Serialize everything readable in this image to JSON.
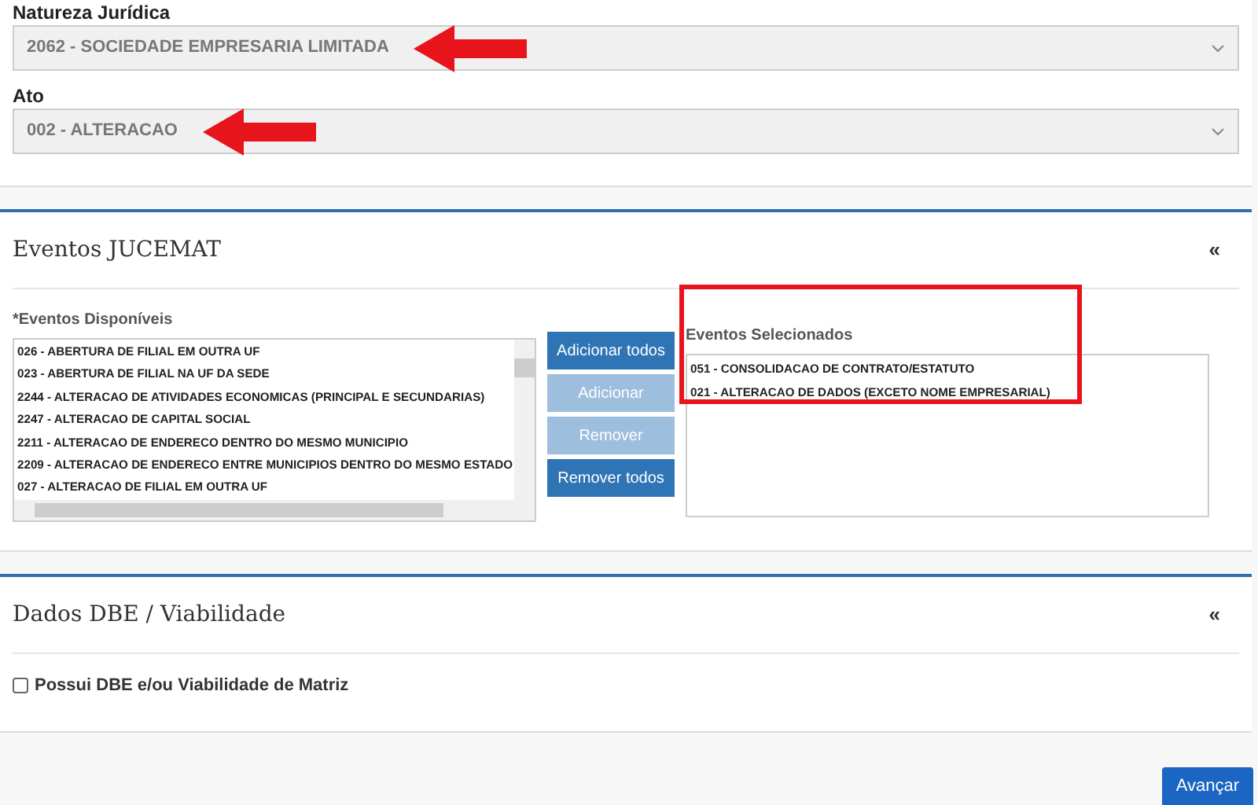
{
  "identificacao": {
    "fields": [
      {
        "label": "Natureza Jurídica",
        "value": "2062 - SOCIEDADE EMPRESARIA LIMITADA",
        "annotated": true
      },
      {
        "label": "Ato",
        "value": "002 - ALTERACAO",
        "annotated": true
      }
    ]
  },
  "eventos": {
    "title": "Eventos JUCEMAT",
    "collapse": "«",
    "available_label": "*Eventos Disponíveis",
    "available": [
      "026 - ABERTURA DE FILIAL EM OUTRA UF",
      "023 - ABERTURA DE FILIAL NA UF DA SEDE",
      "2244 - ALTERACAO DE ATIVIDADES ECONOMICAS (PRINCIPAL E SECUNDARIAS)",
      "2247 - ALTERACAO DE CAPITAL SOCIAL",
      "2211 - ALTERACAO DE ENDERECO DENTRO DO MESMO MUNICIPIO",
      "2209 - ALTERACAO DE ENDERECO ENTRE MUNICIPIOS DENTRO DO MESMO ESTADO",
      "027 - ALTERACAO DE FILIAL EM OUTRA UF"
    ],
    "buttons": [
      {
        "label": "Adicionar todos",
        "disabled": false
      },
      {
        "label": "Adicionar",
        "disabled": true
      },
      {
        "label": "Remover",
        "disabled": true
      },
      {
        "label": "Remover todos",
        "disabled": false
      }
    ],
    "selected_label": "Eventos Selecionados",
    "selected_highlighted": true,
    "selected": [
      "051 - CONSOLIDACAO DE CONTRATO/ESTATUTO",
      "021 - ALTERACAO DE DADOS (EXCETO NOME EMPRESARIAL)"
    ]
  },
  "dbe": {
    "title": "Dados DBE / Viabilidade",
    "collapse": "«",
    "checkbox": {
      "label": "Possui DBE e/ou Viabilidade de Matriz",
      "checked": false
    }
  },
  "next_button": "Avançar"
}
